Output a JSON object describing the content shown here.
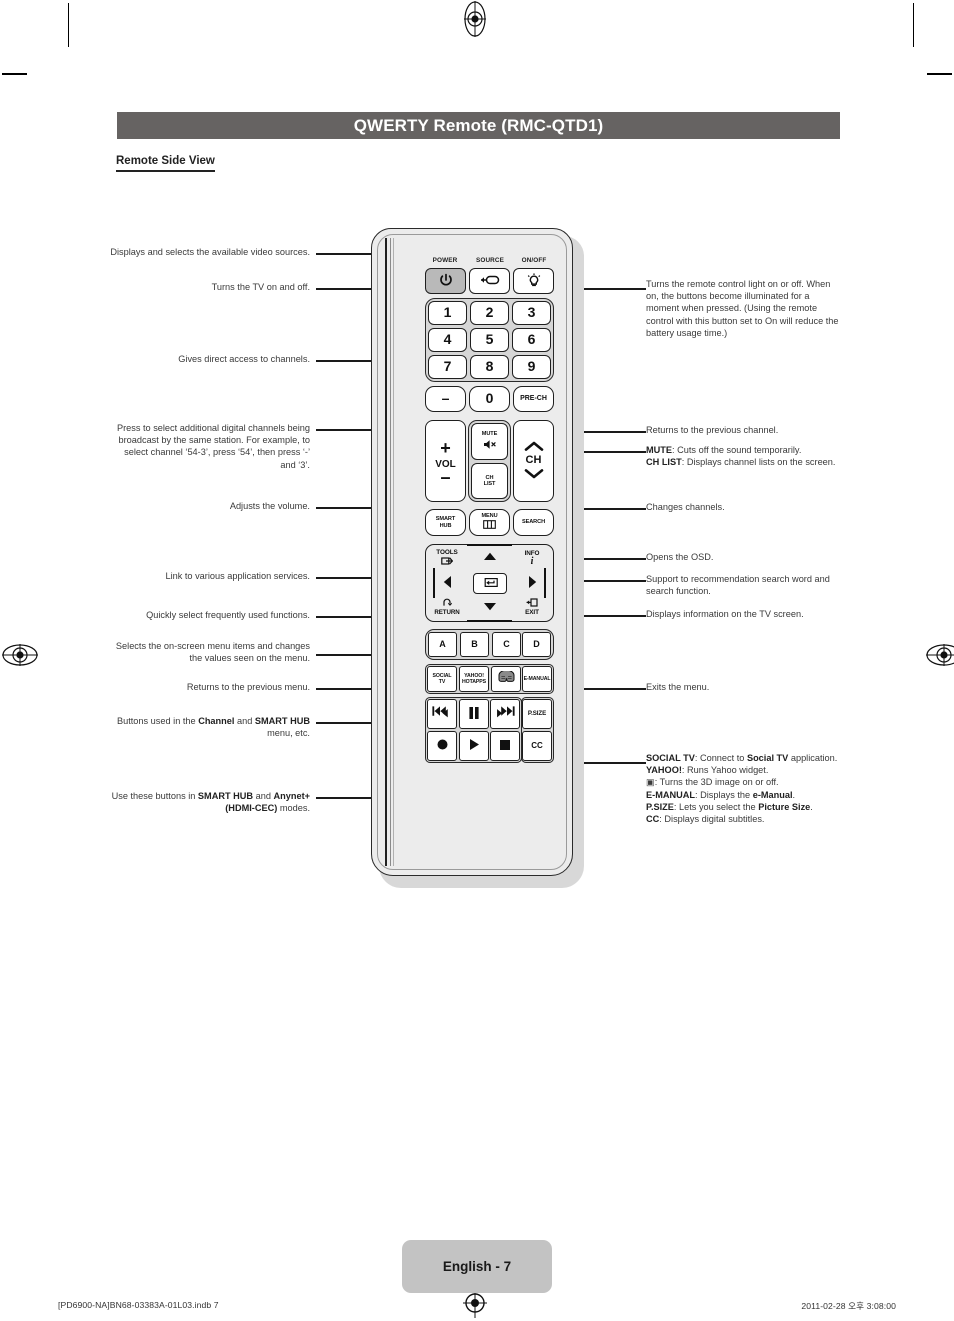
{
  "header": {
    "title": "QWERTY Remote (RMC-QTD1)",
    "section": "Remote Side View"
  },
  "callouts": {
    "left": [
      {
        "id": "source",
        "text": "Displays and selects the available video sources."
      },
      {
        "id": "power",
        "text": "Turns the TV on and off."
      },
      {
        "id": "numbers",
        "text": "Gives direct access to channels."
      },
      {
        "id": "dash",
        "text": "Press to select additional digital channels being broadcast by the same station. For example, to select channel ‘54-3’, press ‘54’, then press ‘-’ and ‘3’."
      },
      {
        "id": "vol",
        "text": "Adjusts the volume."
      },
      {
        "id": "smarthub",
        "text": "Link to various application services."
      },
      {
        "id": "tools",
        "text": "Quickly select frequently used functions."
      },
      {
        "id": "dpad",
        "text": "Selects the on-screen menu items and changes the values seen on the menu."
      },
      {
        "id": "return",
        "text": "Returns to the previous menu."
      },
      {
        "id": "abcd",
        "html": "Buttons used in the <b>Channel</b> and <b>SMART HUB</b> menu, etc."
      },
      {
        "id": "media",
        "html": "Use these buttons in <b>SMART HUB</b> and <b>Anynet+ (HDMI-CEC)</b> modes."
      }
    ],
    "right": [
      {
        "id": "onoff",
        "text": "Turns the remote control light on or off. When on, the buttons become illuminated for a moment when pressed. (Using the remote control with this button set to On will reduce the battery usage time.)"
      },
      {
        "id": "prech",
        "text": "Returns to the previous channel."
      },
      {
        "id": "mute_chlist",
        "html": "<b>MUTE</b>: Cuts off the sound temporarily.<br><b>CH LIST</b>: Displays channel lists on the screen."
      },
      {
        "id": "ch",
        "text": "Changes channels."
      },
      {
        "id": "menu",
        "text": "Opens the OSD."
      },
      {
        "id": "search",
        "text": "Support to recommendation search word and search function."
      },
      {
        "id": "info",
        "text": "Displays information on the TV screen."
      },
      {
        "id": "exit",
        "text": "Exits the menu."
      },
      {
        "id": "apps",
        "html": "<b>SOCIAL TV</b>: Connect to <b>Social TV</b> application.<br><b>YAHOO!</b>: Runs Yahoo widget.<br><span class=\"i3d\">▣</span>: Turns the 3D image on or off.<br><b>E-MANUAL</b>: Displays the <b>e-Manual</b>.<br><b>P.SIZE</b>: Lets you select the <b>Picture Size</b>.<br><b>CC</b>: Displays digital subtitles."
      }
    ]
  },
  "remote": {
    "top_labels": {
      "power": "POWER",
      "source": "SOURCE",
      "onoff": "ON/OFF"
    },
    "keys": {
      "power": "power-icon",
      "source": "source-icon",
      "light": "bulb-icon",
      "numbers": [
        "1",
        "2",
        "3",
        "4",
        "5",
        "6",
        "7",
        "8",
        "9"
      ],
      "dash": "–",
      "zero": "0",
      "prech": "PRE-CH",
      "vol_plus": "+",
      "vol_label": "VOL",
      "vol_minus": "–",
      "mute_label": "MUTE",
      "chlist_l1": "CH",
      "chlist_l2": "LIST",
      "ch_label": "CH",
      "smart_l1": "SMART",
      "smart_l2": "HUB",
      "menu_label": "MENU",
      "search_label": "SEARCH",
      "tools_label": "TOOLS",
      "info_label": "INFO",
      "return_label": "RETURN",
      "exit_label": "EXIT",
      "color": [
        "A",
        "B",
        "C",
        "D"
      ],
      "social_l1": "SOCIAL",
      "social_l2": "TV",
      "yahoo_l1": "YAHOO!",
      "yahoo_l2": "HOTAPPS",
      "threed": "3d-glasses-icon",
      "emanual": "E-MANUAL",
      "psize": "P.SIZE",
      "cc": "CC",
      "rew": "◀◀",
      "pause": "▐▐",
      "ff": "▶▶",
      "rec": "●",
      "play": "▶",
      "stop": "■"
    }
  },
  "footer": {
    "page_label": "English - 7",
    "file": "[PD6900-NA]BN68-03383A-01L03.indb   7",
    "timestamp": "2011-02-28   오후 3:08:00"
  }
}
